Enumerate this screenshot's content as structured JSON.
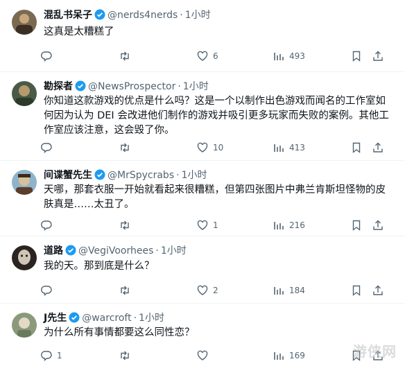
{
  "tweets": [
    {
      "name": "混乱书呆子",
      "handle": "@nerds4nerds",
      "dot": "·",
      "time": "1小时",
      "lines": [
        "这真是太糟糕了"
      ],
      "replies": "",
      "retweets": "",
      "likes": "6",
      "views": "493"
    },
    {
      "name": "勘探者",
      "handle": "@NewsProspector",
      "dot": "·",
      "time": "1小时",
      "lines": [
        "你知道这款游戏的优点是什么吗？这是一个以制作出色游戏而闻名的工作室如",
        "何因为认为 DEI 会改进他们制作的游戏并吸引更多玩家而失败的案例。其他工",
        "作室应该注意，这会毁了你。"
      ],
      "replies": "",
      "retweets": "",
      "likes": "10",
      "views": "413"
    },
    {
      "name": "间谍蟹先生",
      "handle": "@MrSpycrabs",
      "dot": "·",
      "time": "1小时",
      "lines": [
        "天哪，那套衣服一开始就看起来很糟糕，但第四张图片中弗兰肯斯坦怪物的皮",
        "肤真是……太丑了。"
      ],
      "replies": "",
      "retweets": "",
      "likes": "1",
      "views": "216"
    },
    {
      "name": "道路",
      "handle": "@VegiVoorhees",
      "dot": "·",
      "time": "1小时",
      "lines": [
        "我的天。那到底是什么？"
      ],
      "replies": "",
      "retweets": "",
      "likes": "2",
      "views": "184"
    },
    {
      "name": "J先生",
      "handle": "@warcroft",
      "dot": "·",
      "time": "1小时",
      "lines": [
        "为什么所有事情都要这么同性恋？"
      ],
      "replies": "1",
      "retweets": "",
      "likes": "",
      "views": "169"
    }
  ],
  "watermark": "游侠网",
  "colors": {
    "verified": "#1d9bf0",
    "muted": "#536471",
    "text": "#0f1419"
  }
}
